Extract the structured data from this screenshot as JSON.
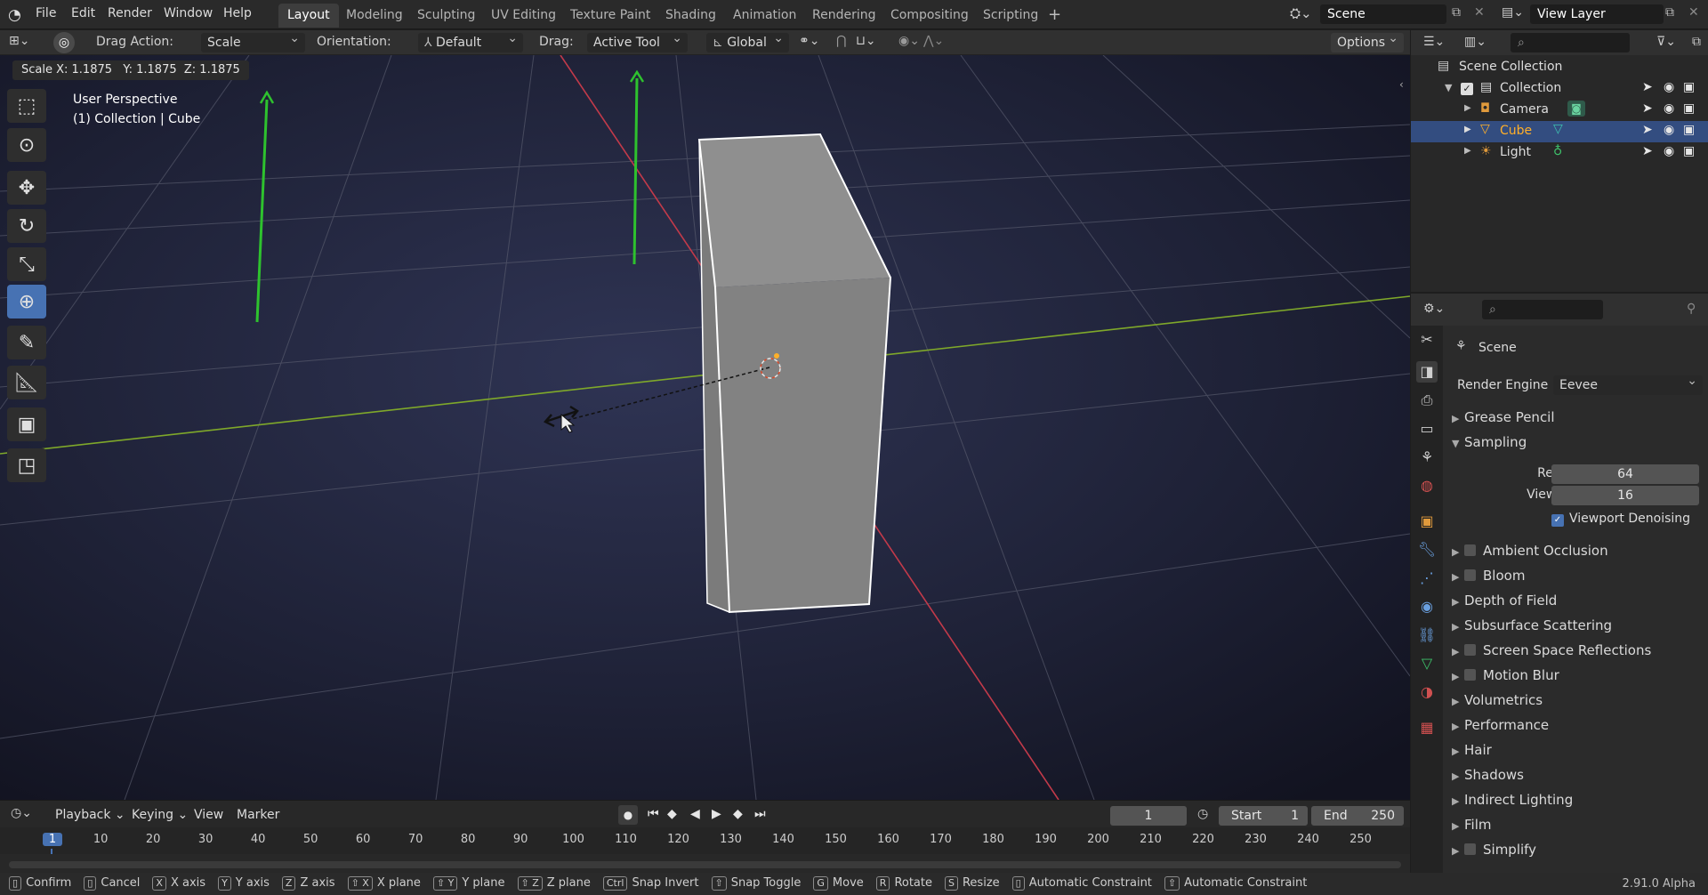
{
  "menu": {
    "items": [
      "File",
      "Edit",
      "Render",
      "Window",
      "Help"
    ]
  },
  "workspaces": [
    "Layout",
    "Modeling",
    "Sculpting",
    "UV Editing",
    "Texture Paint",
    "Shading",
    "Animation",
    "Rendering",
    "Compositing",
    "Scripting"
  ],
  "top_right": {
    "scene": "Scene",
    "view_layer": "View Layer"
  },
  "tool_header": {
    "drag_action_label": "Drag Action:",
    "drag_action_value": "Scale",
    "orientation_label": "Orientation:",
    "orientation_value": "Default",
    "drag_label": "Drag:",
    "drag_value": "Active Tool",
    "transform_value": "Global",
    "options": "Options"
  },
  "viewport": {
    "scale_readout": "Scale X: 1.1875   Y: 1.1875  Z: 1.1875",
    "perspective": "User Perspective",
    "context": "(1) Collection | Cube"
  },
  "outliner": {
    "root": "Scene Collection",
    "collection": "Collection",
    "items": [
      {
        "name": "Camera",
        "selected": false
      },
      {
        "name": "Cube",
        "selected": true
      },
      {
        "name": "Light",
        "selected": false
      }
    ]
  },
  "properties": {
    "context": "Scene",
    "render_engine_label": "Render Engine",
    "render_engine": "Eevee",
    "grease_pencil": "Grease Pencil",
    "sampling": "Sampling",
    "render_label": "Render",
    "render_samples": "64",
    "viewport_label": "Viewport",
    "viewport_samples": "16",
    "viewport_denoising": "Viewport Denoising",
    "panels": [
      {
        "label": "Ambient Occlusion",
        "checkbox": true
      },
      {
        "label": "Bloom",
        "checkbox": true
      },
      {
        "label": "Depth of Field",
        "checkbox": false
      },
      {
        "label": "Subsurface Scattering",
        "checkbox": false
      },
      {
        "label": "Screen Space Reflections",
        "checkbox": true
      },
      {
        "label": "Motion Blur",
        "checkbox": true
      },
      {
        "label": "Volumetrics",
        "checkbox": false
      },
      {
        "label": "Performance",
        "checkbox": false
      },
      {
        "label": "Hair",
        "checkbox": false
      },
      {
        "label": "Shadows",
        "checkbox": false
      },
      {
        "label": "Indirect Lighting",
        "checkbox": false
      },
      {
        "label": "Film",
        "checkbox": false
      },
      {
        "label": "Simplify",
        "checkbox": true
      }
    ]
  },
  "timeline": {
    "menus": [
      "Playback",
      "Keying",
      "View",
      "Marker"
    ],
    "current_frame": "1",
    "start_label": "Start",
    "start": "1",
    "end_label": "End",
    "end": "250",
    "ruler": [
      "1",
      "10",
      "20",
      "30",
      "40",
      "50",
      "60",
      "70",
      "80",
      "90",
      "100",
      "110",
      "120",
      "130",
      "140",
      "150",
      "160",
      "170",
      "180",
      "190",
      "200",
      "210",
      "220",
      "230",
      "240",
      "250"
    ]
  },
  "statusbar": {
    "items": [
      {
        "key": "",
        "label": "Confirm"
      },
      {
        "key": "",
        "label": "Cancel"
      },
      {
        "key": "X",
        "label": "X axis"
      },
      {
        "key": "Y",
        "label": "Y axis"
      },
      {
        "key": "Z",
        "label": "Z axis"
      },
      {
        "key": "⇧ X",
        "label": "X plane"
      },
      {
        "key": "⇧ Y",
        "label": "Y plane"
      },
      {
        "key": "⇧ Z",
        "label": "Z plane"
      },
      {
        "key": "Ctrl",
        "label": "Snap Invert"
      },
      {
        "key": "⇧",
        "label": "Snap Toggle"
      },
      {
        "key": "G",
        "label": "Move"
      },
      {
        "key": "R",
        "label": "Rotate"
      },
      {
        "key": "S",
        "label": "Resize"
      },
      {
        "key": "",
        "label": "Automatic Constraint"
      },
      {
        "key": "⇧",
        "label": "Automatic Constraint"
      }
    ],
    "version": "2.91.0 Alpha"
  },
  "colors": {
    "accent": "#4772b3",
    "selected_text": "#ffaf29",
    "x_axis": "#c23a4a",
    "y_axis": "#7fa82a",
    "bg_top": "#3b3f5c",
    "bg_bottom": "#161826"
  }
}
